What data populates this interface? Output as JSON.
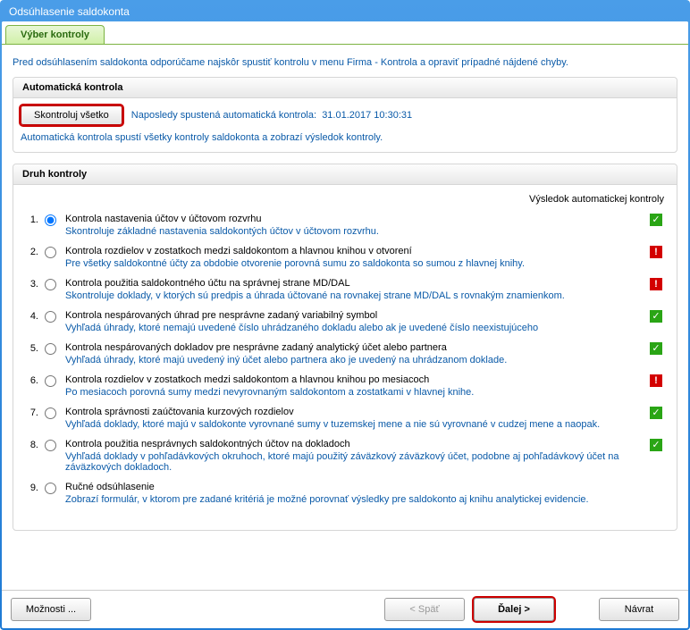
{
  "window": {
    "title": "Odsúhlasenie saldokonta"
  },
  "tab": {
    "main": "Výber kontroly"
  },
  "intro": "Pred odsúhlasením saldokonta odporúčame najskôr spustiť kontrolu v menu Firma - Kontrola a opraviť prípadné nájdené chyby.",
  "auto_panel": {
    "title": "Automatická kontrola",
    "button": "Skontroluj všetko",
    "last_run_label": "Naposledy spustená automatická kontrola:",
    "last_run_time": "31.01.2017 10:30:31",
    "desc": "Automatická kontrola spustí všetky kontroly saldokonta a zobrazí výsledok kontroly."
  },
  "controls_panel": {
    "title": "Druh kontroly",
    "result_header": "Výsledok automatickej kontroly",
    "items": [
      {
        "num": "1.",
        "title": "Kontrola nastavenia účtov v účtovom rozvrhu",
        "desc": "Skontroluje základné nastavenia saldokontých účtov v účtovom rozvrhu.",
        "result": "ok",
        "selected": true
      },
      {
        "num": "2.",
        "title": "Kontrola rozdielov v zostatkoch medzi saldokontom a hlavnou knihou v otvorení",
        "desc": "Pre všetky saldokontné účty za obdobie otvorenie porovná sumu zo saldokonta so sumou z hlavnej knihy.",
        "result": "warn",
        "selected": false
      },
      {
        "num": "3.",
        "title": "Kontrola použitia saldokontného účtu na správnej strane MD/DAL",
        "desc": "Skontroluje doklady, v ktorých sú predpis a úhrada účtované na rovnakej strane MD/DAL s rovnakým znamienkom.",
        "result": "warn",
        "selected": false
      },
      {
        "num": "4.",
        "title": "Kontrola nespárovaných úhrad pre nesprávne zadaný variabilný symbol",
        "desc": "Vyhľadá úhrady, ktoré nemajú uvedené číslo uhrádzaného dokladu alebo ak je uvedené číslo neexistujúceho",
        "result": "ok",
        "selected": false
      },
      {
        "num": "5.",
        "title": "Kontrola nespárovaných dokladov pre nesprávne zadaný analytický účet alebo partnera",
        "desc": "Vyhľadá úhrady, ktoré majú uvedený iný účet alebo partnera ako je uvedený na uhrádzanom doklade.",
        "result": "ok",
        "selected": false
      },
      {
        "num": "6.",
        "title": "Kontrola rozdielov v zostatkoch medzi saldokontom a hlavnou knihou po mesiacoch",
        "desc": "Po mesiacoch porovná sumy medzi nevyrovnaným saldokontom a zostatkami v hlavnej knihe.",
        "result": "warn",
        "selected": false
      },
      {
        "num": "7.",
        "title": "Kontrola správnosti zaúčtovania kurzových rozdielov",
        "desc": "Vyhľadá doklady, ktoré majú v saldokonte vyrovnané sumy v tuzemskej mene a nie sú vyrovnané v cudzej mene a naopak.",
        "result": "ok",
        "selected": false
      },
      {
        "num": "8.",
        "title": "Kontrola použitia nesprávnych saldokontných účtov na dokladoch",
        "desc": "Vyhľadá doklady v pohľadávkových okruhoch, ktoré majú použitý záväzkový záväzkový účet, podobne aj pohľadávkový účet na záväzkových dokladoch.",
        "result": "ok",
        "selected": false
      },
      {
        "num": "9.",
        "title": "Ručné odsúhlasenie",
        "desc": "Zobrazí formulár, v ktorom pre zadané kritériá je možné porovnať výsledky pre saldokonto aj knihu analytickej evidencie.",
        "result": "none",
        "selected": false
      }
    ]
  },
  "footer": {
    "options": "Možnosti ...",
    "back": "< Späť",
    "next": "Ďalej >",
    "cancel": "Návrat"
  },
  "icons": {
    "check": "✓",
    "warn": "!"
  }
}
